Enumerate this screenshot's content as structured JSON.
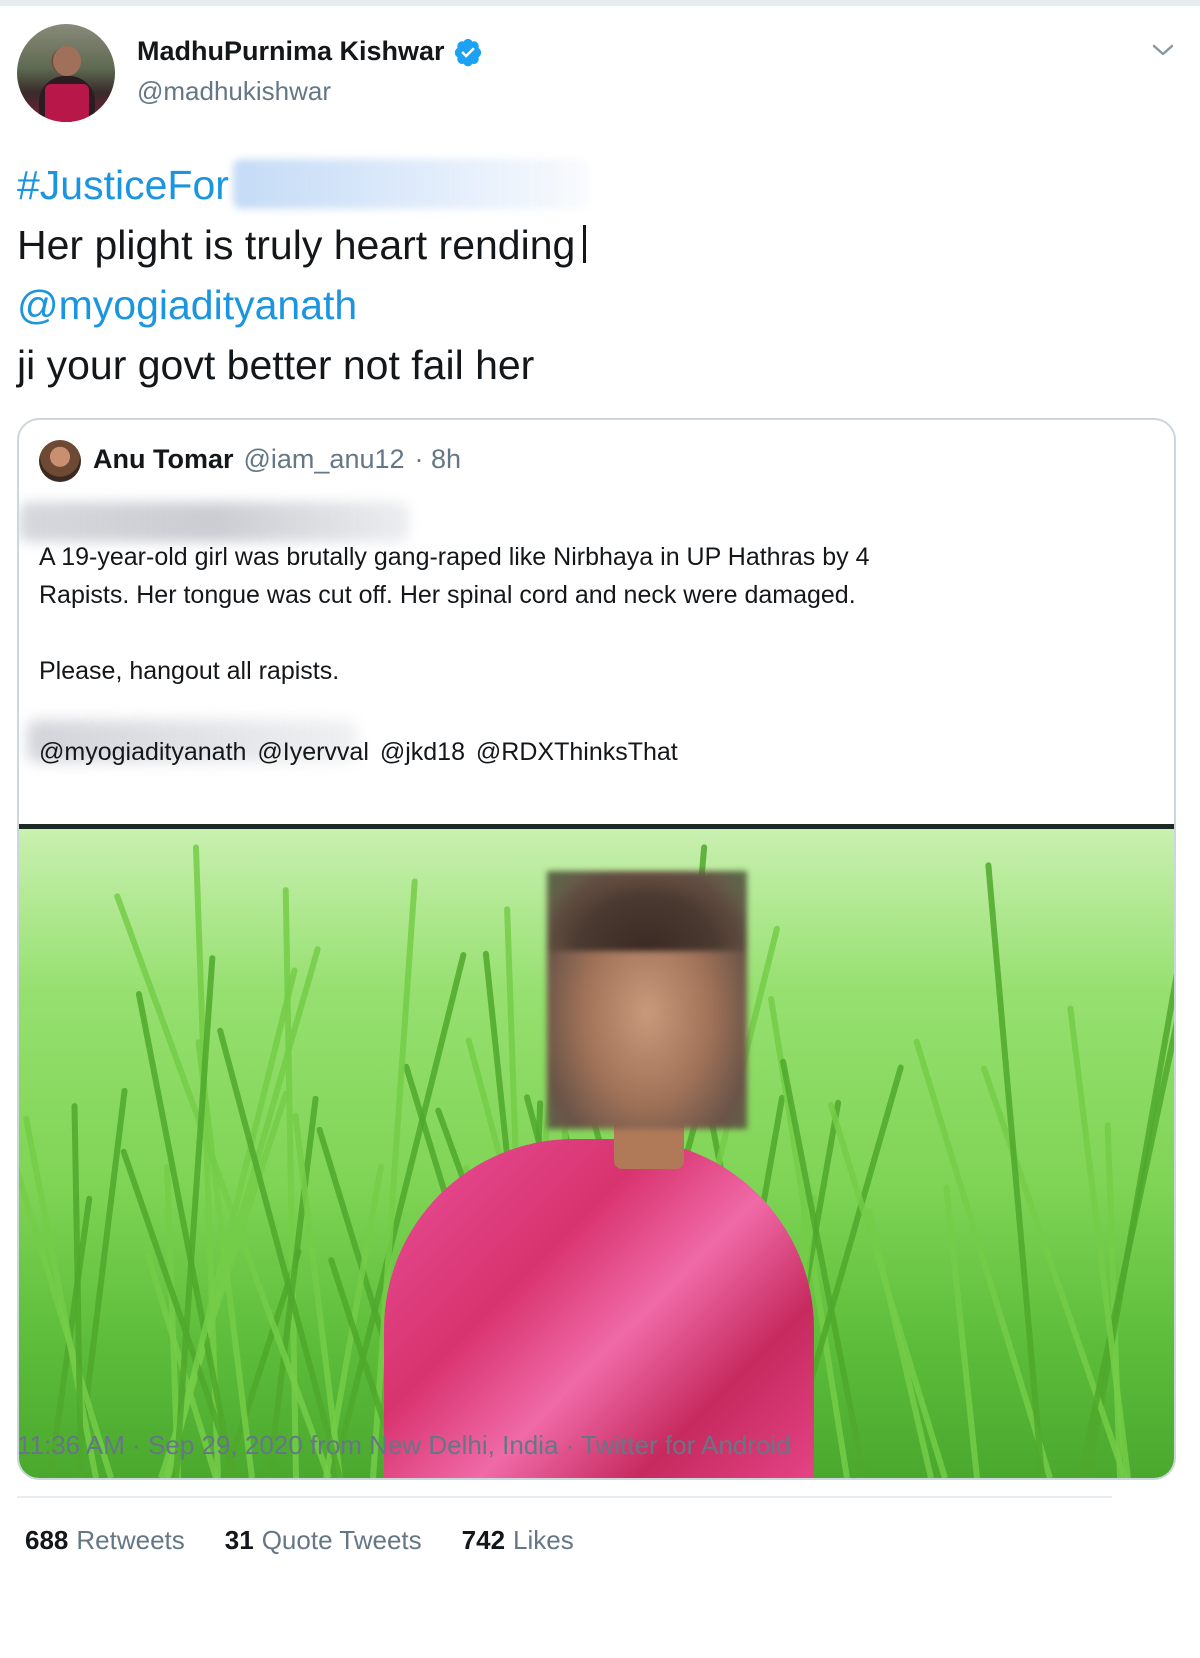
{
  "author": {
    "display_name": "MadhuPurnima Kishwar",
    "handle": "@madhukishwar",
    "verified": true,
    "avatar_icon": "avatar-photo"
  },
  "tweet": {
    "hashtag": "#JusticeFor",
    "line2": "Her plight is truly heart rending",
    "mention": "@myogiadityanath",
    "line4": "ji your govt better not fail her"
  },
  "quoted_tweet": {
    "name": "Anu Tomar",
    "handle": "@iam_anu12",
    "age": "· 8h",
    "text_line1": "A 19-year-old girl was brutally gang-raped like Nirbhaya in UP Hathras by 4",
    "text_line2": "Rapists. Her tongue was cut off. Her spinal cord and neck were damaged.",
    "text_line3": "Please, hangout all rapists.",
    "mentions": "@myogiadityanath @Iyervval @jkd18  @RDXThinksThat"
  },
  "footer": {
    "timestamp": "11:36 AM · Sep 29, 2020 from New Delhi, India · Twitter for Android",
    "retweets_count": "688",
    "retweets_label": "Retweets",
    "quotes_count": "31",
    "quotes_label": "Quote Tweets",
    "likes_count": "742",
    "likes_label": "Likes"
  },
  "colors": {
    "link": "#1b95e0",
    "secondary_text": "#657786",
    "border": "#ccd6dd",
    "verified_badge": "#1da1f2"
  }
}
